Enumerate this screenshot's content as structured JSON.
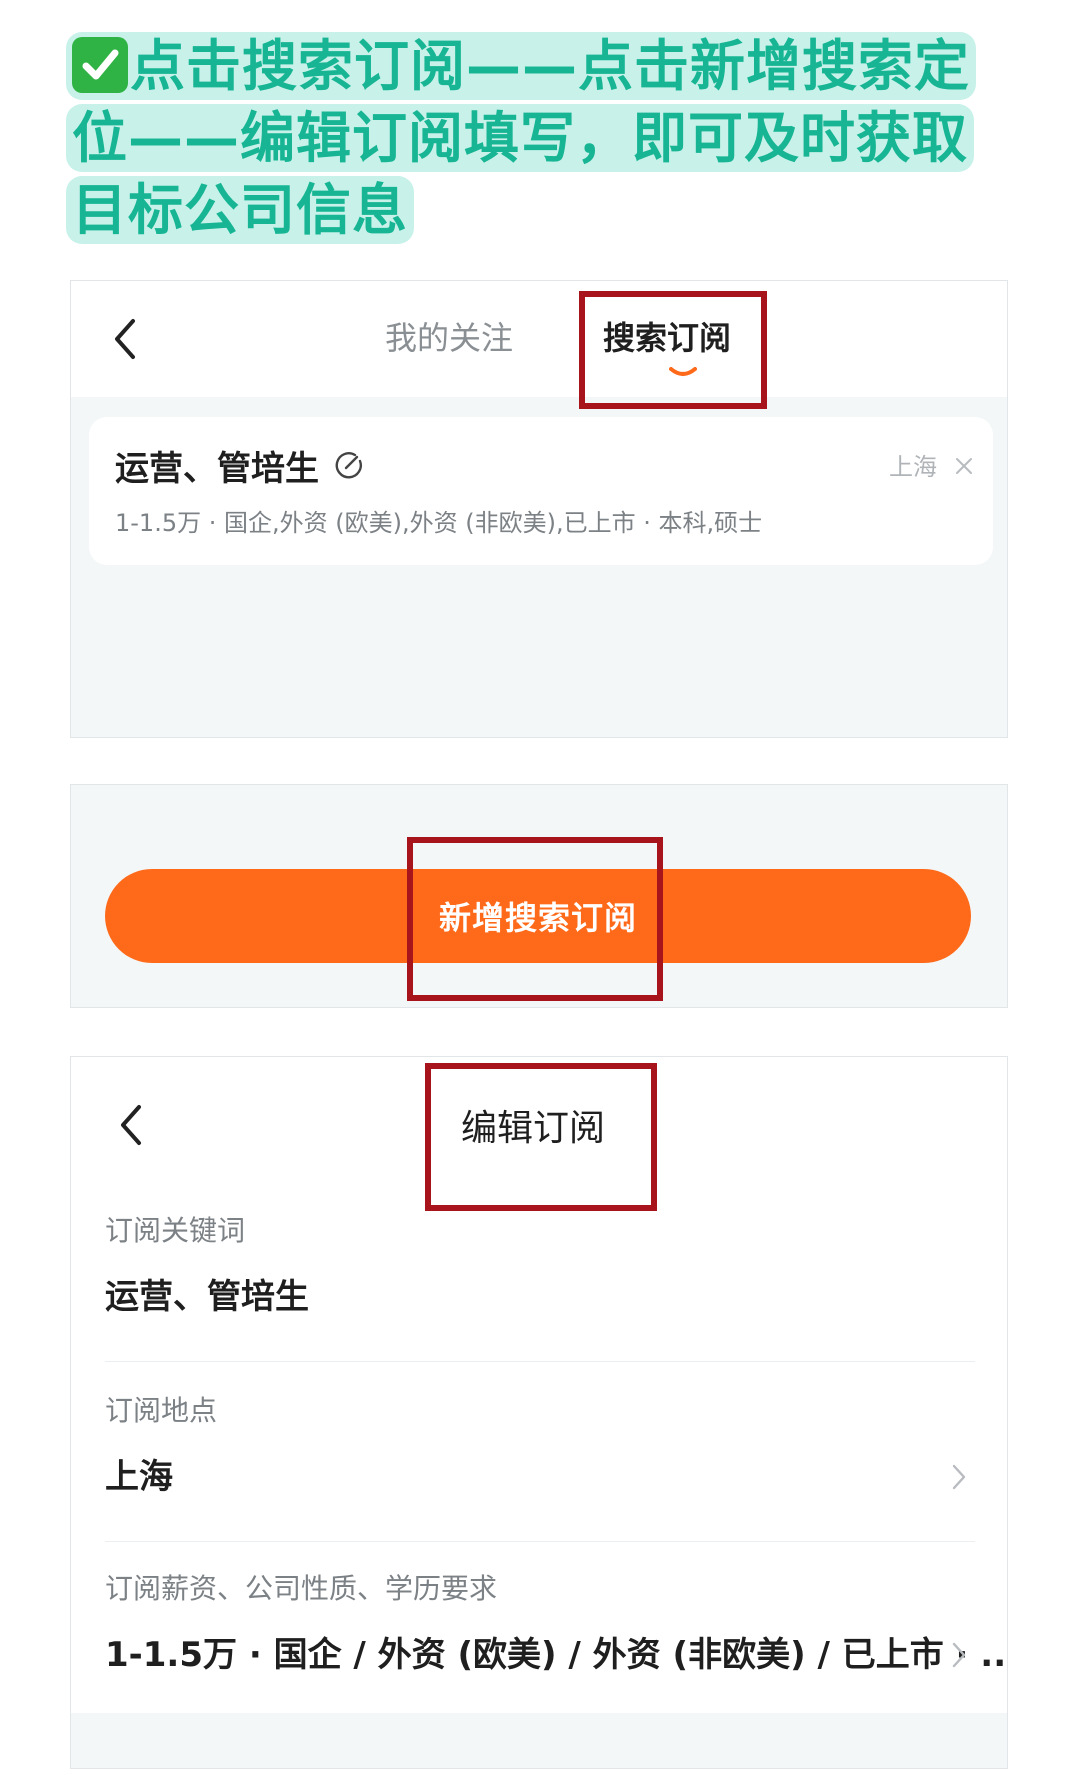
{
  "headline": {
    "text": "点击搜索订阅——点击新增搜索定位——编辑订阅填写，即可及时获取目标公司信息"
  },
  "panel1": {
    "tabs": [
      {
        "label": "我的关注"
      },
      {
        "label": "搜索订阅"
      }
    ],
    "subscription": {
      "title": "运营、管培生",
      "city": "上海",
      "meta": "1-1.5万 · 国企,外资 (欧美),外资 (非欧美),已上市 · 本科,硕士"
    }
  },
  "panel2": {
    "add_button_label": "新增搜索订阅"
  },
  "panel3": {
    "title": "编辑订阅",
    "fields": [
      {
        "label": "订阅关键词",
        "value": "运营、管培生"
      },
      {
        "label": "订阅地点",
        "value": "上海"
      },
      {
        "label": "订阅薪资、公司性质、学历要求",
        "value": "1-1.5万 · 国企 / 外资 (欧美) / 外资 (非欧美) / 已上市 · ..."
      }
    ]
  },
  "colors": {
    "accent_orange": "#ff6a1a",
    "headline_green": "#17b594",
    "headline_highlight": "#c8f2e9",
    "annotation_red": "#a8141c",
    "check_green": "#2fb344"
  }
}
